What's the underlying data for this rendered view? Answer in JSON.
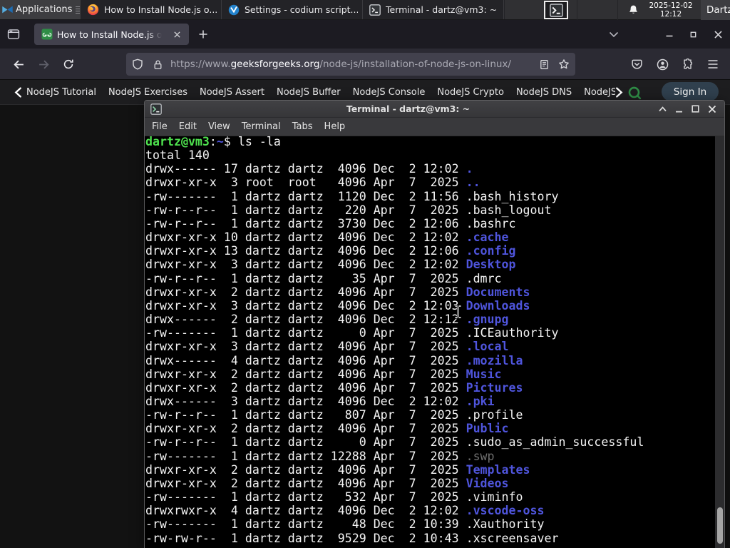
{
  "panel": {
    "applications_label": "Applications",
    "tasks": [
      {
        "icon": "firefox-icon",
        "label": "How to Install Node.js o..."
      },
      {
        "icon": "codium-icon",
        "label": "Settings - codium script..."
      },
      {
        "icon": "terminal-icon",
        "label": "Terminal - dartz@vm3: ~"
      }
    ],
    "clock_date": "2025-12-02",
    "clock_time": "12:12",
    "user_label": "Dartz"
  },
  "browser": {
    "tab_title": "How to Install Node.js on Linux",
    "url_scheme": "https://www.",
    "url_domain": "geeksforgeeks.org",
    "url_path": "/node-js/installation-of-node-js-on-linux/"
  },
  "site_nav": {
    "items": [
      "NodeJS Tutorial",
      "NodeJS Exercises",
      "NodeJS Assert",
      "NodeJS Buffer",
      "NodeJS Console",
      "NodeJS Crypto",
      "NodeJS DNS",
      "NodeJS File System"
    ],
    "sign_in_label": "Sign In"
  },
  "terminal": {
    "title": "Terminal - dartz@vm3: ~",
    "menu": [
      "File",
      "Edit",
      "View",
      "Terminal",
      "Tabs",
      "Help"
    ],
    "prompt_user": "dartz@vm3",
    "prompt_sep": ":",
    "prompt_path": "~",
    "prompt_symbol": "$ ",
    "command": "ls -la",
    "total_line": "total 140",
    "lines": [
      {
        "pre": "drwx------ 17 dartz dartz  4096 Dec  2 12:02 ",
        "name": ".",
        "cls": "dir"
      },
      {
        "pre": "drwxr-xr-x  3 root  root   4096 Apr  7  2025 ",
        "name": "..",
        "cls": "dir"
      },
      {
        "pre": "-rw-------  1 dartz dartz  1120 Dec  2 11:56 ",
        "name": ".bash_history",
        "cls": "fg"
      },
      {
        "pre": "-rw-r--r--  1 dartz dartz   220 Apr  7  2025 ",
        "name": ".bash_logout",
        "cls": "fg"
      },
      {
        "pre": "-rw-r--r--  1 dartz dartz  3730 Dec  2 12:06 ",
        "name": ".bashrc",
        "cls": "fg"
      },
      {
        "pre": "drwxr-xr-x 10 dartz dartz  4096 Dec  2 12:02 ",
        "name": ".cache",
        "cls": "dir"
      },
      {
        "pre": "drwxr-xr-x 13 dartz dartz  4096 Dec  2 12:06 ",
        "name": ".config",
        "cls": "dir"
      },
      {
        "pre": "drwxr-xr-x  3 dartz dartz  4096 Dec  2 12:02 ",
        "name": "Desktop",
        "cls": "dir"
      },
      {
        "pre": "-rw-r--r--  1 dartz dartz    35 Apr  7  2025 ",
        "name": ".dmrc",
        "cls": "fg"
      },
      {
        "pre": "drwxr-xr-x  2 dartz dartz  4096 Apr  7  2025 ",
        "name": "Documents",
        "cls": "dir"
      },
      {
        "pre": "drwxr-xr-x  3 dartz dartz  4096 Dec  2 12:03 ",
        "name": "Downloads",
        "cls": "dir"
      },
      {
        "pre": "drwx------  2 dartz dartz  4096 Dec  2 12:12 ",
        "name": ".gnupg",
        "cls": "dir"
      },
      {
        "pre": "-rw-------  1 dartz dartz     0 Apr  7  2025 ",
        "name": ".ICEauthority",
        "cls": "fg"
      },
      {
        "pre": "drwxr-xr-x  3 dartz dartz  4096 Apr  7  2025 ",
        "name": ".local",
        "cls": "dir"
      },
      {
        "pre": "drwx------  4 dartz dartz  4096 Apr  7  2025 ",
        "name": ".mozilla",
        "cls": "dir"
      },
      {
        "pre": "drwxr-xr-x  2 dartz dartz  4096 Apr  7  2025 ",
        "name": "Music",
        "cls": "dir"
      },
      {
        "pre": "drwxr-xr-x  2 dartz dartz  4096 Apr  7  2025 ",
        "name": "Pictures",
        "cls": "dir"
      },
      {
        "pre": "drwx------  3 dartz dartz  4096 Dec  2 12:02 ",
        "name": ".pki",
        "cls": "dir"
      },
      {
        "pre": "-rw-r--r--  1 dartz dartz   807 Apr  7  2025 ",
        "name": ".profile",
        "cls": "fg"
      },
      {
        "pre": "drwxr-xr-x  2 dartz dartz  4096 Apr  7  2025 ",
        "name": "Public",
        "cls": "dir"
      },
      {
        "pre": "-rw-r--r--  1 dartz dartz     0 Apr  7  2025 ",
        "name": ".sudo_as_admin_successful",
        "cls": "fg"
      },
      {
        "pre": "-rw-------  1 dartz dartz 12288 Apr  7  2025 ",
        "name": ".swp",
        "cls": "dim"
      },
      {
        "pre": "drwxr-xr-x  2 dartz dartz  4096 Apr  7  2025 ",
        "name": "Templates",
        "cls": "dir"
      },
      {
        "pre": "drwxr-xr-x  2 dartz dartz  4096 Apr  7  2025 ",
        "name": "Videos",
        "cls": "dir"
      },
      {
        "pre": "-rw-------  1 dartz dartz   532 Apr  7  2025 ",
        "name": ".viminfo",
        "cls": "fg"
      },
      {
        "pre": "drwxrwxr-x  4 dartz dartz  4096 Dec  2 12:02 ",
        "name": ".vscode-oss",
        "cls": "dir"
      },
      {
        "pre": "-rw-------  1 dartz dartz    48 Dec  2 10:39 ",
        "name": ".Xauthority",
        "cls": "fg"
      },
      {
        "pre": "-rw-rw-r--  1 dartz dartz  9529 Dec  2 10:43 ",
        "name": ".xscreensaver",
        "cls": "fg"
      }
    ]
  }
}
